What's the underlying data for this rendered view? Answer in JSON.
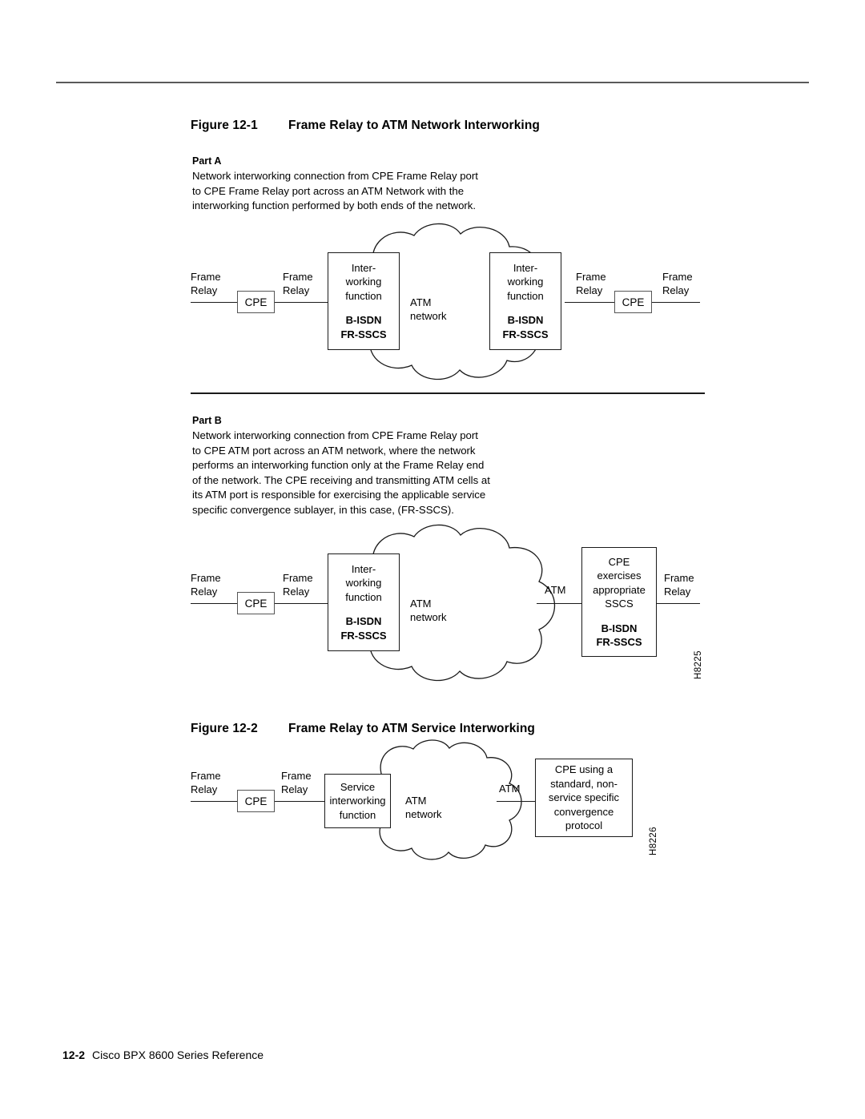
{
  "document": {
    "footer_page": "12-2",
    "footer_title": "Cisco BPX 8600 Series Reference"
  },
  "figure1": {
    "number": "Figure 12-1",
    "title": "Frame Relay to ATM Network Interworking",
    "part_a": {
      "heading": "Part A",
      "body": "Network interworking connection from CPE Frame Relay port\nto CPE Frame Relay port across an ATM Network with the\ninterworking function performed by both ends of the network.",
      "diagram": {
        "label_fr_left_outer": "Frame\nRelay",
        "cpe_left": "CPE",
        "label_fr_left_inner": "Frame\nRelay",
        "iwf_left_top": "Inter-\nworking\nfunction",
        "iwf_left_bottom": "B-ISDN\nFR-SSCS",
        "cloud_label": "ATM network",
        "iwf_right_top": "Inter-\nworking\nfunction",
        "iwf_right_bottom": "B-ISDN\nFR-SSCS",
        "label_fr_right_inner": "Frame\nRelay",
        "cpe_right": "CPE",
        "label_fr_right_outer": "Frame\nRelay"
      }
    },
    "part_b": {
      "heading": "Part B",
      "body": "Network interworking connection from CPE Frame Relay port\nto CPE ATM port across an ATM network, where the network\nperforms an interworking function only at the Frame Relay end\nof the network. The CPE receiving and transmitting ATM cells at\nits ATM port is responsible for exercising the applicable service\nspecific convergence sublayer, in this case, (FR-SSCS).",
      "diagram": {
        "label_fr_left_outer": "Frame\nRelay",
        "cpe_left": "CPE",
        "label_fr_left_inner": "Frame\nRelay",
        "iwf_top": "Inter-\nworking\nfunction",
        "iwf_bottom": "B-ISDN\nFR-SSCS",
        "cloud_label": "ATM network",
        "label_atm": "ATM",
        "cpe_box_top": "CPE\nexercises\nappropriate\nSSCS",
        "cpe_box_bottom": "B-ISDN\nFR-SSCS",
        "label_fr_right": "Frame\nRelay",
        "figure_id": "H8225"
      }
    }
  },
  "figure2": {
    "number": "Figure 12-2",
    "title": "Frame Relay to ATM Service Interworking",
    "diagram": {
      "label_fr_left_outer": "Frame\nRelay",
      "cpe_left": "CPE",
      "label_fr_left_inner": "Frame\nRelay",
      "siwf": "Service\ninterworking\nfunction",
      "cloud_label": "ATM network",
      "label_atm": "ATM",
      "cpe_right_box": "CPE using a\nstandard, non-\nservice specific\nconvergence\nprotocol",
      "figure_id": "H8226"
    }
  }
}
